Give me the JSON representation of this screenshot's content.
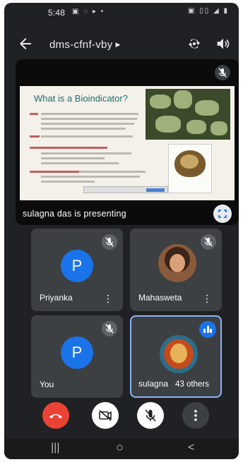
{
  "status_bar": {
    "time": "5:48",
    "left_icons": "▣ ◌ ▸ •",
    "right_icons": "▣ ▯▯ ◢ ▮"
  },
  "top_bar": {
    "meeting_code": "dms-cfnf-vby"
  },
  "presentation": {
    "presenter_text": "sulagna das is presenting",
    "slide": {
      "title": "What is a Bioindicator?"
    }
  },
  "participants": [
    {
      "name": "Priyanka",
      "initial": "P"
    },
    {
      "name": "Mahasweta"
    },
    {
      "name": "You",
      "initial": "P"
    },
    {
      "name": "sulagna",
      "others_label": "43 others"
    }
  ],
  "icons": {
    "back": "arrow-back-icon",
    "flip_camera": "flip-camera-icon",
    "speaker": "speaker-icon",
    "muted_mic": "mic-off-icon",
    "fullscreen": "fullscreen-icon",
    "more": "more-vert-icon",
    "end_call": "call-end-icon",
    "camera_off": "camera-off-icon",
    "speaking": "audio-level-icon"
  },
  "colors": {
    "background": "#202124",
    "tile": "#3c4043",
    "end_call": "#ea4335",
    "accent_blue": "#1a73e8",
    "active_border": "#8ab4f8"
  },
  "nav_bar": {
    "recent": "|||",
    "home": "○",
    "back": "<"
  }
}
